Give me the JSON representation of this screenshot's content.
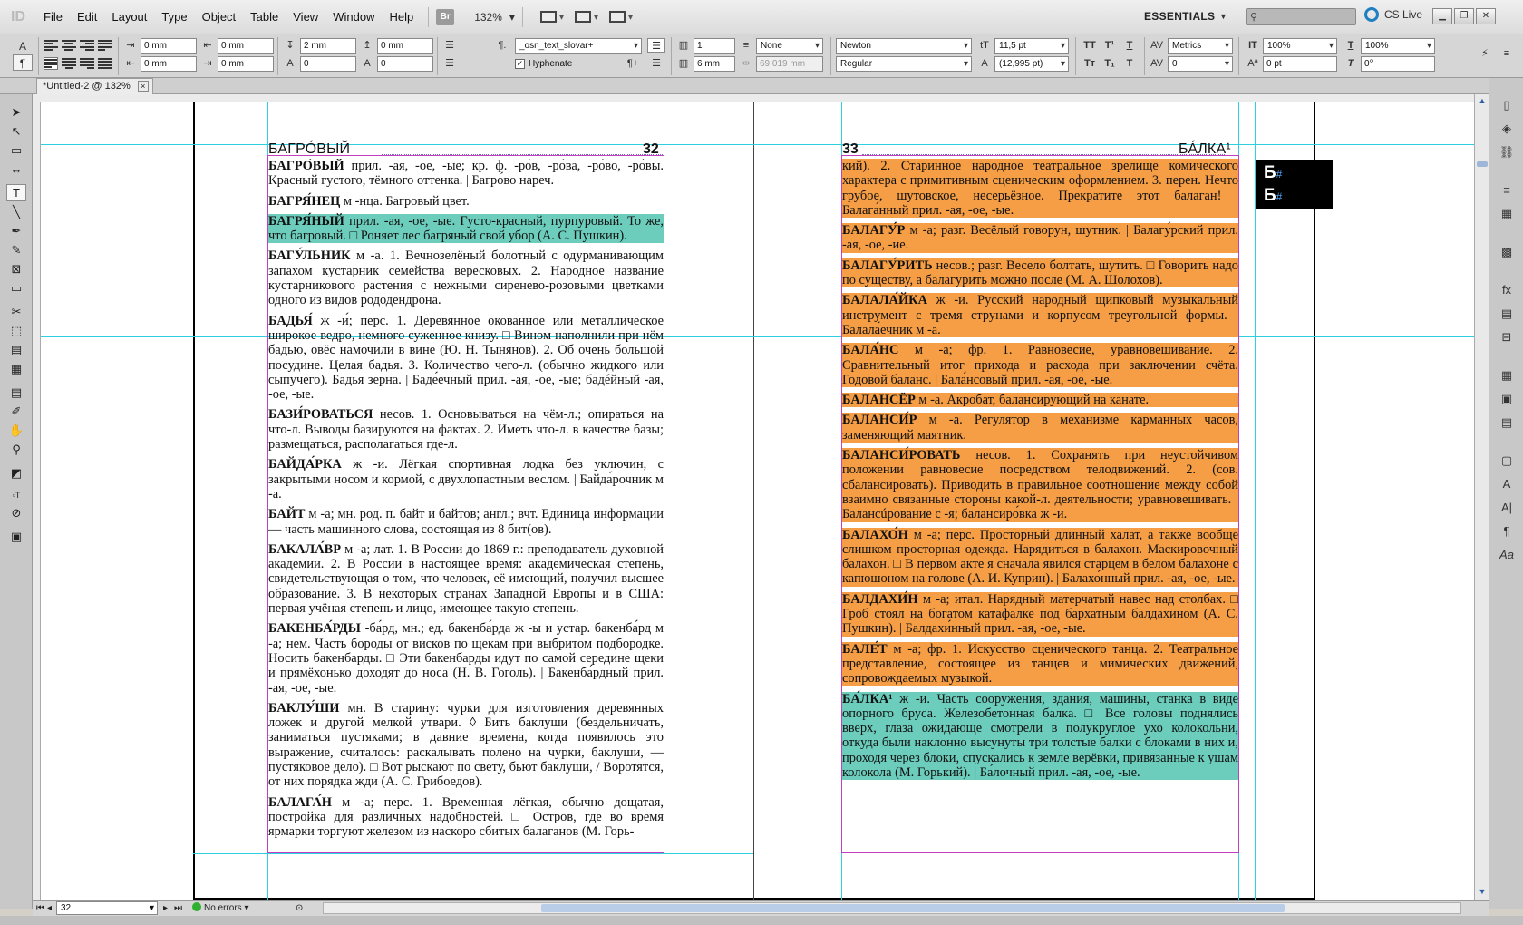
{
  "app": {
    "logo": "ID",
    "menus": [
      "File",
      "Edit",
      "Layout",
      "Type",
      "Object",
      "Table",
      "View",
      "Window",
      "Help"
    ],
    "bridge_badge": "Br",
    "zoom": "132%",
    "workspace": "ESSENTIALS",
    "search_placeholder": "",
    "cs_live": "CS Live"
  },
  "control_panel": {
    "left_indent": "0 mm",
    "first_line_indent": "0 mm",
    "right_indent": "0 mm",
    "last_line_indent": "0 mm",
    "space_before": "2 mm",
    "space_after": "0 mm",
    "drop_cap_lines": "0",
    "drop_cap_chars": "0",
    "paragraph_style": "_osn_text_slovar+",
    "hyphenate_label": "Hyphenate",
    "columns": "1",
    "column_gutter": "6 mm",
    "span": "None",
    "span_width": "69,019 mm",
    "font_family": "Newton",
    "font_style": "Regular",
    "font_size": "11,5 pt",
    "leading": "(12,995 pt)",
    "kerning": "Metrics",
    "tracking": "0",
    "vertical_scale": "100%",
    "horizontal_scale": "100%",
    "baseline_shift": "0 pt",
    "skew": "0°"
  },
  "document": {
    "tab_title": "*Untitled-2 @ 132%",
    "left_page": {
      "running_head": "БАГРО́ВЫЙ",
      "page_number": "32",
      "entries": [
        {
          "head": "БАГРО́ВЫЙ",
          "body": " прил. -ая, -ое, -ые; кр. ф. -ро́в, -ро́ва, -ро́во, -ро́вы. Красный густого, тёмного оттенка. | Багро́во нареч.",
          "hl": ""
        },
        {
          "head": "БАГРЯ́НЕЦ",
          "body": " м -нца. Багровый цвет.",
          "hl": ""
        },
        {
          "head": "БАГРЯ́НЫЙ",
          "body": " прил. -ая, -ое, -ые. Густо-красный, пурпуровый. То же, что багровый. □ Роняет лес багряный свой убор (А. С. Пушкин).",
          "hl": "teal"
        },
        {
          "head": "БАГУ́ЛЬНИК",
          "body": " м -а. 1. Вечнозелёный болотный с одурманивающим запахом кустарник семейства вересковых. 2. Народное название кустарникового растения с нежными сиренево-розовыми цветками одного из видов рододендрона.",
          "hl": ""
        },
        {
          "head": "БАДЬЯ́",
          "body": " ж -и́; перс. 1. Деревянное окованное или металлическое широкое ведро, немного суженное книзу. □ Вином наполнили при нём бадью, овёс намочили в вине (Ю. Н. Тынянов). 2. Об очень большой посудине. Целая бадья. 3. Количество чего-л. (обычно жидкого или сыпучего). Бадья зерна. | Баде́ечный прил. -ая, -ое, -ые; бадéйный -ая, -ое, -ые.",
          "hl": ""
        },
        {
          "head": "БАЗИ́РОВАТЬСЯ",
          "body": " несов. 1. Основываться на чём-л.; опираться на что-л. Выводы базируются на фактах. 2. Иметь что-л. в качестве базы; размещаться, располагаться где-л.",
          "hl": ""
        },
        {
          "head": "БАЙДА́РКА",
          "body": " ж -и. Лёгкая спортивная лодка без уключин, с закрытыми носом и кормой, с двухлопастным веслом. | Байда́рочник м -а.",
          "hl": ""
        },
        {
          "head": "БАЙТ",
          "body": " м -а; мн. род. п. байт и байтов; англ.; вчт. Единица информации — часть машинного слова, состоящая из 8 бит(ов).",
          "hl": ""
        },
        {
          "head": "БАКАЛА́ВР",
          "body": " м -а; лат. 1. В России до 1869 г.: преподаватель духовной академии. 2. В России в настоящее время: академическая степень, свидетельствующая о том, что человек, её имеющий, получил высшее образование. 3. В некоторых странах Западной Европы и в США: первая учёная степень и лицо, имеющее такую степень.",
          "hl": ""
        },
        {
          "head": "БАКЕНБА́РДЫ",
          "body": " -ба́рд, мн.; ед. бакенба́рда ж -ы и устар. бакенба́рд м -а; нем. Часть бороды от висков по щекам при выбритом подбородке. Носить бакенбарды. □ Эти бакенбарды идут по самой середине щеки и прямёхонько доходят до носа (Н. В. Гоголь). | Бакенба́рдный прил. -ая, -ое, -ые.",
          "hl": ""
        },
        {
          "head": "БАКЛУ́ШИ",
          "body": " мн. В старину: чурки для изготовления деревянных ложек и другой мелкой утвари. ◊ Бить баклуши (бездельничать, заниматься пустяками; в давние времена, когда появилось это выражение, считалось: раскалывать полено на чурки, баклуши, — пустяковое дело). □ Вот рыскают по свету, бьют баклуши, / Воротятся, от них порядка жди (А. С. Грибоедов).",
          "hl": ""
        },
        {
          "head": "БАЛАГА́Н",
          "body": " м -а; перс. 1. Временная лёгкая, обычно дощатая, постройка для различных надобностей. □ Остров, где во время ярмарки торгуют железом из наскоро сбитых балаганов (М. Горь-",
          "hl": ""
        }
      ]
    },
    "right_page": {
      "running_head": "БА́ЛКА¹",
      "page_number": "33",
      "entries": [
        {
          "head": "",
          "body": "кий). 2. Старинное народное театральное зрелище комического характера с примитивным сценическим оформлением. 3. перен. Нечто грубое, шутовское, несерьёзное. Прекратите этот балаган! | Балага́нный прил. -ая, -ое, -ые.",
          "hl": "orange"
        },
        {
          "head": "БАЛАГУ́Р",
          "body": " м -а; разг. Весёлый говорун, шутник. | Балагу́рский прил. -ая, -ое, -ие.",
          "hl": "orange"
        },
        {
          "head": "БАЛАГУ́РИТЬ",
          "body": " несов.; разг. Весело болтать, шутить. □ Говорить надо по существу, а балагурить можно после (М. А. Шолохов).",
          "hl": "orange"
        },
        {
          "head": "БАЛАЛА́ЙКА",
          "body": " ж -и. Русский народный щипковый музыкальный инструмент с тремя струнами и корпусом треугольной формы. | Балала́ечник м -а.",
          "hl": "orange"
        },
        {
          "head": "БАЛА́НС",
          "body": " м -а; фр. 1. Равновесие, уравновешивание. 2. Сравнительный итог прихода и расхода при заключении счёта. Годовой баланс. | Бала́нсовый прил. -ая, -ое, -ые.",
          "hl": "orange"
        },
        {
          "head": "БАЛАНСЁР",
          "body": " м -а. Акробат, балансирующий на канате.",
          "hl": "orange"
        },
        {
          "head": "БАЛАНСИ́Р",
          "body": " м -а. Регулятор в механизме карманных часов, заменяющий маятник.",
          "hl": "orange"
        },
        {
          "head": "БАЛАНСИ́РОВАТЬ",
          "body": " несов. 1. Сохранять при неустойчивом положении равновесие посредством телодвижений. 2. (сов. сбалансировать). Приводить в правильное соотношение между собой взаимно связанные стороны какой-л. деятельности; уравновешивать. | Балансúрование с -я; балансиро́вка ж -и.",
          "hl": "orange"
        },
        {
          "head": "БАЛАХО́Н",
          "body": " м -а; перс. Просторный длинный халат, а также вообще слишком просторная одежда. Нарядиться в балахон. Маскировочный балахон. □ В первом акте я сначала явился старцем в белом балахоне с капюшоном на голове (А. И. Куприн). | Балахо́нный прил. -ая, -ое, -ые.",
          "hl": "orange"
        },
        {
          "head": "БАЛДАХИ́Н",
          "body": " м -а; итал. Нарядный матерчатый навес над столбах. □ Гроб стоял на богатом катафалке под бархатным балдахином (А. С. Пушкин). | Балдахи́нный прил. -ая, -ое, -ые.",
          "hl": "orange"
        },
        {
          "head": "БАЛЕ́Т",
          "body": " м -а; фр. 1. Искусство сценического танца. 2. Театральное представление, состоящее из танцев и мимических движений, сопровождаемых музыкой.",
          "hl": "orange"
        },
        {
          "head": "БА́ЛКА¹",
          "body": " ж -и. Часть сооружения, здания, машины, станка в виде опорного бруса. Железобетонная балка. □ Все головы поднялись вверх, глаза ожидающе смотрели в полукруглое ухо колокольни, откуда были наклонно высунуты три толстые балки с блоками в них и, проходя через блоки, спускались к земле верёвки, привязанные к ушам колокола (М. Горький). | Ба́лочный прил. -ая, -ое, -ые.",
          "hl": "teal"
        }
      ]
    },
    "letter_marker": [
      "Б",
      "Б"
    ]
  },
  "status": {
    "page": "32",
    "preflight": "No errors"
  }
}
